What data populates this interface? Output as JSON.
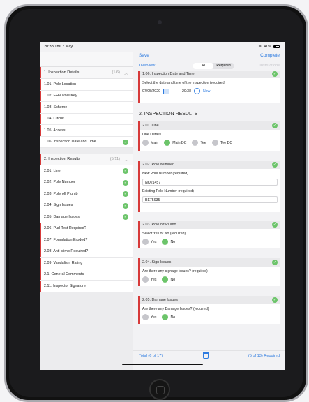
{
  "status": {
    "time": "20:38 Thu 7 May",
    "battery": "41%"
  },
  "nav": {
    "save": "Save",
    "complete": "Complete"
  },
  "tabs": {
    "overview": "Overview",
    "all": "All",
    "required": "Required",
    "instructions": "Instructions"
  },
  "sidebar": {
    "section1": {
      "label": "1. Inspection Details",
      "count": "(1/6)"
    },
    "items1": [
      {
        "label": "1.01. Pole Location",
        "done": false
      },
      {
        "label": "1.02. EHV Pole Key",
        "done": false
      },
      {
        "label": "1.03. Scheme",
        "done": false
      },
      {
        "label": "1.04. Circuit",
        "done": false
      },
      {
        "label": "1.05. Access",
        "done": false
      },
      {
        "label": "1.06. Inspection Date and Time",
        "done": true
      }
    ],
    "section2": {
      "label": "2. Inspection Results",
      "count": "(5/11)"
    },
    "items2": [
      {
        "label": "2.01. Line",
        "done": true
      },
      {
        "label": "2.02. Pole Number",
        "done": true
      },
      {
        "label": "2.03. Pole off Plumb",
        "done": true
      },
      {
        "label": "2.04. Sign Issues",
        "done": true
      },
      {
        "label": "2.05. Damage Issues",
        "done": true
      },
      {
        "label": "2.06. Purl Test Required?",
        "done": false
      },
      {
        "label": "2.07. Foundation Eroded?",
        "done": false
      },
      {
        "label": "2.08. Anti-climb Required?",
        "done": false
      },
      {
        "label": "2.09. Vandalism Rating",
        "done": false
      },
      {
        "label": "2.1. General Comments",
        "done": false
      },
      {
        "label": "2.11. Inspector Signature",
        "done": false
      }
    ]
  },
  "cards": {
    "c106": {
      "title": "1.06. Inspection Date and Time",
      "question": "Select the date and time of the Inspection (required)",
      "date": "07/05/2020",
      "time": "20:38",
      "now": "Now"
    },
    "section2_title": "2. INSPECTION RESULTS",
    "c201": {
      "title": "2.01. Line",
      "question": "Line Details",
      "options": [
        "Main",
        "Main DC",
        "Tee",
        "Tee DC"
      ],
      "selected": "Main DC"
    },
    "c202": {
      "title": "2.02. Pole Number",
      "q1": "New Pole Number (required)",
      "v1": "NO21457",
      "q2": "Existing Pole Number (required)",
      "v2": "BE75935"
    },
    "c203": {
      "title": "2.03. Pole off Plumb",
      "question": "Select Yes or No (required)",
      "yes": "Yes",
      "no": "No"
    },
    "c204": {
      "title": "2.04. Sign Issues",
      "question": "Are there any signage issues? (required)",
      "yes": "Yes",
      "no": "No"
    },
    "c205": {
      "title": "2.05. Damage Issues",
      "question": "Are there any Damage Issues? (required)",
      "yes": "Yes",
      "no": "No"
    }
  },
  "bottom": {
    "total": "Total (6 of 17)",
    "required": "(5 of 13) Required"
  }
}
